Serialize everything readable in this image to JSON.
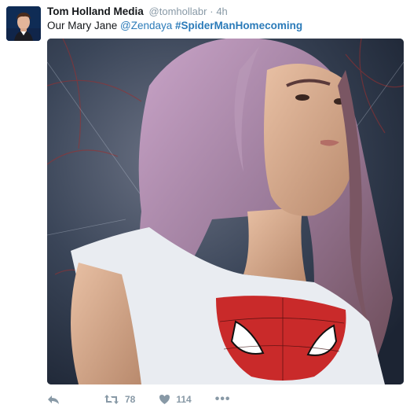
{
  "tweet": {
    "author_name": "Tom Holland Media",
    "handle": "@tomhollabr",
    "separator": "·",
    "time": "4h",
    "text_prefix": "Our Mary Jane ",
    "mention": "@Zendaya",
    "hashtag": "#SpiderManHomecoming",
    "media_icon": "photo",
    "actions": {
      "reply_icon": "reply-icon",
      "retweet_icon": "retweet-icon",
      "retweet_count": "78",
      "like_icon": "heart-icon",
      "like_count": "114",
      "more_icon": "more-icon",
      "more_label": "•••"
    }
  },
  "colors": {
    "link": "#2b7bb9",
    "muted": "#8899a6",
    "text": "#14171a"
  }
}
